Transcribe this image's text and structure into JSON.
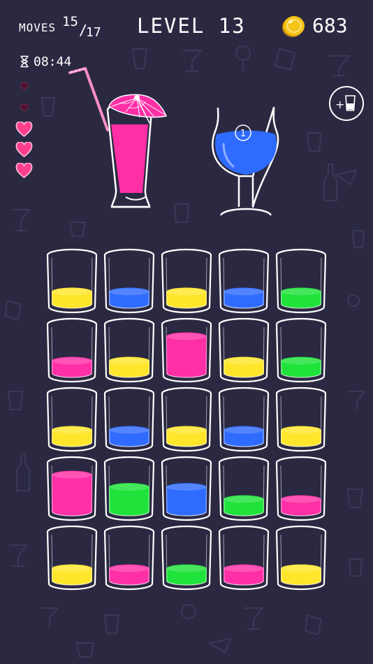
{
  "header": {
    "moves_label": "MOVES",
    "moves_current": "15",
    "moves_slash": "/",
    "moves_max": "17",
    "level_text": "LEVEL 13",
    "coins": "683"
  },
  "timer": {
    "icon": "hourglass-icon",
    "time": "08:44"
  },
  "lives": {
    "total": 5,
    "remaining": 3
  },
  "targets": [
    {
      "name": "pink-cocktail",
      "liquid_color": "#ff2fa6",
      "decoration": "cocktail-umbrella-and-straw"
    },
    {
      "name": "blue-cocktail",
      "liquid_color": "#2f6bff",
      "badge": "1"
    }
  ],
  "add_tube_button": {
    "plus": "+",
    "icon": "glass-icon"
  },
  "colors": {
    "yellow": "#ffe62b",
    "blue": "#2f6bff",
    "green": "#1fe23a",
    "pink": "#ff2fa6",
    "background": "#2b2942",
    "coin": "#f5c518"
  },
  "grid": {
    "columns": 5,
    "tubes": [
      {
        "color": "yellow",
        "level": 0.25
      },
      {
        "color": "blue",
        "level": 0.25
      },
      {
        "color": "yellow",
        "level": 0.25
      },
      {
        "color": "blue",
        "level": 0.25
      },
      {
        "color": "green",
        "level": 0.25
      },
      {
        "color": "pink",
        "level": 0.25
      },
      {
        "color": "yellow",
        "level": 0.25
      },
      {
        "color": "pink",
        "level": 0.75
      },
      {
        "color": "yellow",
        "level": 0.25
      },
      {
        "color": "green",
        "level": 0.25
      },
      {
        "color": "yellow",
        "level": 0.25
      },
      {
        "color": "blue",
        "level": 0.25
      },
      {
        "color": "yellow",
        "level": 0.25
      },
      {
        "color": "blue",
        "level": 0.25
      },
      {
        "color": "yellow",
        "level": 0.25
      },
      {
        "color": "pink",
        "level": 0.75
      },
      {
        "color": "green",
        "level": 0.5
      },
      {
        "color": "blue",
        "level": 0.5
      },
      {
        "color": "green",
        "level": 0.25
      },
      {
        "color": "pink",
        "level": 0.25
      },
      {
        "color": "yellow",
        "level": 0.25
      },
      {
        "color": "pink",
        "level": 0.25
      },
      {
        "color": "green",
        "level": 0.25
      },
      {
        "color": "pink",
        "level": 0.25
      },
      {
        "color": "yellow",
        "level": 0.25
      }
    ]
  }
}
